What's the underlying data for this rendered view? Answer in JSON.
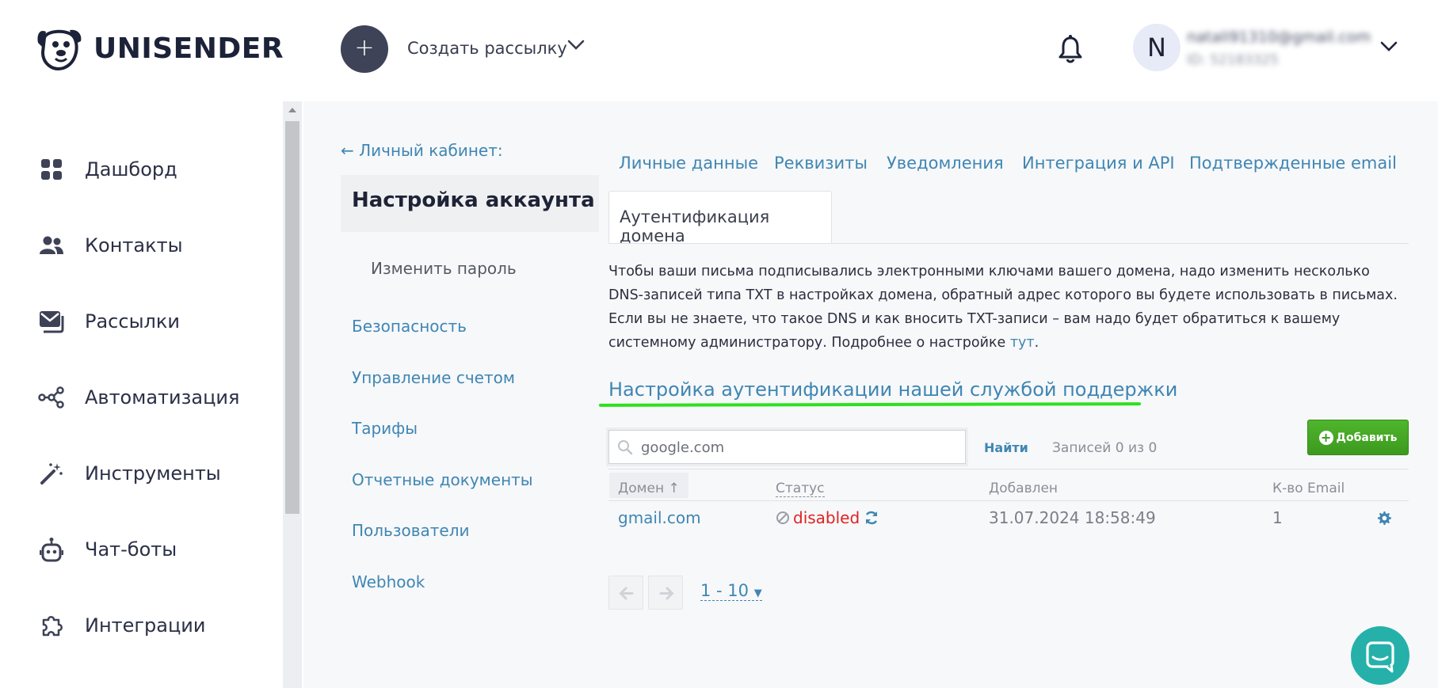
{
  "app": {
    "brand": "UNISENDER"
  },
  "header": {
    "create_button": "+",
    "create_label": "Создать рассылку",
    "avatar_letter": "N",
    "user_email": "natali91310@gmail.com",
    "user_id": "ID: 52183325"
  },
  "sidebar": {
    "items": [
      {
        "label": "Дашборд",
        "icon": "dashboard-icon"
      },
      {
        "label": "Контакты",
        "icon": "contacts-icon"
      },
      {
        "label": "Рассылки",
        "icon": "mailings-icon"
      },
      {
        "label": "Автоматизация",
        "icon": "automation-icon"
      },
      {
        "label": "Инструменты",
        "icon": "tools-icon"
      },
      {
        "label": "Чат-боты",
        "icon": "chatbot-icon"
      },
      {
        "label": "Интеграции",
        "icon": "integrations-icon"
      }
    ]
  },
  "account": {
    "back_link": "← Личный кабинет:",
    "section_title": "Настройка аккаунта",
    "current_item": "Изменить пароль",
    "links": [
      "Безопасность",
      "Управление счетом",
      "Тарифы",
      "Отчетные документы",
      "Пользователи",
      "Webhook"
    ]
  },
  "tabs": {
    "items": [
      "Личные данные",
      "Реквизиты",
      "Уведомления",
      "Интеграция и API",
      "Подтвержденные email"
    ],
    "active": "Аутентификация домена"
  },
  "content": {
    "description": "Чтобы ваши письма подписывались электронными ключами вашего домена, надо изменить несколько DNS-записей типа TXT в настройках домена, обратный адрес которого вы будете использовать в письмах. Если вы не знаете, что такое DNS и как вносить TXT-записи – вам надо будет обратиться к вашему системному администратору. Подробнее о настройке ",
    "description_link": "тут",
    "description_end": ".",
    "support_link": "Настройка аутентификации нашей службой поддержки"
  },
  "table_controls": {
    "search_placeholder": "google.com",
    "find_button": "Найти",
    "records": "Записей 0 из 0",
    "add_button": "Добавить"
  },
  "table": {
    "headers": {
      "domain": "Домен",
      "status": "Статус",
      "added": "Добавлен",
      "count": "К-во Email"
    },
    "rows": [
      {
        "domain": "gmail.com",
        "status": "disabled",
        "added": "31.07.2024 18:58:49",
        "count": "1"
      }
    ]
  },
  "pagination": {
    "range": "1 - 10"
  },
  "colors": {
    "accent": "#3f86b3",
    "brand_dark": "#1c2238",
    "add_green": "#46a825",
    "highlight": "#2ee01f",
    "chat": "#25b1a9",
    "disabled_red": "#e02222"
  }
}
